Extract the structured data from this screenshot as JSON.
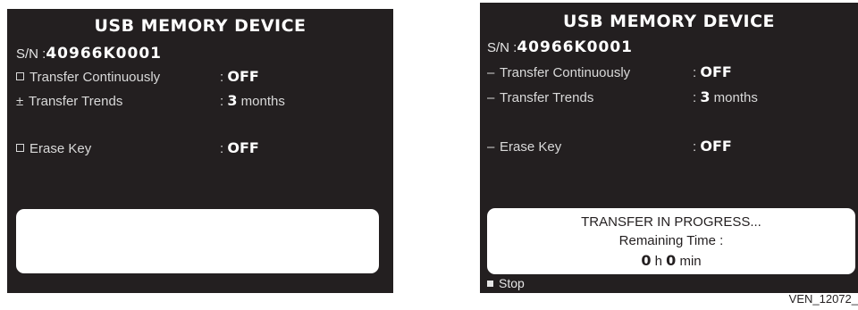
{
  "left_screen": {
    "title": "USB MEMORY DEVICE",
    "sn_label": "S/N :",
    "sn_value": "40966K0001",
    "items": [
      {
        "marker": "box",
        "label": "Transfer Continuously",
        "colon": ":",
        "value": "OFF",
        "unit": ""
      },
      {
        "marker": "±",
        "label": "Transfer Trends",
        "colon": ":",
        "value": "3",
        "unit": "months"
      },
      {
        "marker": "box",
        "label": "Erase Key",
        "colon": ":",
        "value": "OFF",
        "unit": ""
      }
    ],
    "message_box": ""
  },
  "right_screen": {
    "title": "USB MEMORY DEVICE",
    "sn_label": "S/N :",
    "sn_value": "40966K0001",
    "items": [
      {
        "marker": "–",
        "label": "Transfer Continuously",
        "colon": ":",
        "value": "OFF",
        "unit": ""
      },
      {
        "marker": "–",
        "label": "Transfer Trends",
        "colon": ":",
        "value": "3",
        "unit": "months"
      },
      {
        "marker": "–",
        "label": "Erase Key",
        "colon": ":",
        "value": "OFF",
        "unit": ""
      }
    ],
    "message_box": {
      "line1": "TRANSFER IN PROGRESS...",
      "line2": "Remaining Time :",
      "hours": "0",
      "hours_unit": "h",
      "minutes": "0",
      "minutes_unit": "min"
    },
    "stop_label": "Stop"
  },
  "caption": "VEN_12072_",
  "colors": {
    "screen_bg": "#231f20",
    "text": "#e6e6e6",
    "message_bg": "#ffffff"
  },
  "icons": {
    "checkbox": "checkbox-icon",
    "stop": "stop-square-icon"
  }
}
